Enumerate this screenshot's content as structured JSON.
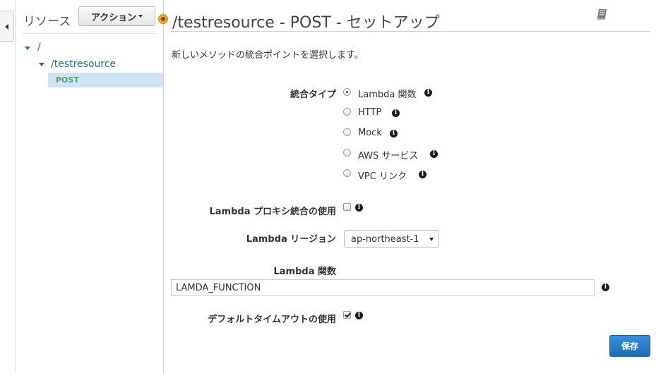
{
  "sidebar": {
    "title": "リソース",
    "action_label": "アクション",
    "tree": {
      "root": "/",
      "resource": "/testresource",
      "method": "POST"
    }
  },
  "header": {
    "title": "/testresource - POST - セットアップ"
  },
  "form": {
    "description": "新しいメソッドの統合ポイントを選択します。",
    "integration_type_label": "統合タイプ",
    "integration_types": [
      {
        "label": "Lambda 関数",
        "checked": true
      },
      {
        "label": "HTTP",
        "checked": false
      },
      {
        "label": "Mock",
        "checked": false
      },
      {
        "label": "AWS サービス",
        "checked": false
      },
      {
        "label": "VPC リンク",
        "checked": false
      }
    ],
    "proxy_label": "Lambda プロキシ統合の使用",
    "proxy_checked": false,
    "region_label": "Lambda リージョン",
    "region_value": "ap-northeast-1",
    "function_label": "Lambda 関数",
    "function_value": "LAMDA_FUNCTION",
    "timeout_label": "デフォルトタイムアウトの使用",
    "timeout_checked": true,
    "save_label": "保存"
  },
  "icons": {
    "info": "info-circle-icon",
    "book": "book-icon"
  },
  "colors": {
    "link": "#1f6fb5",
    "selected_row": "#cfe4f6",
    "method": "#4fa85c",
    "save_button": "#1d6ab5",
    "status_dot": "#f3a625"
  }
}
